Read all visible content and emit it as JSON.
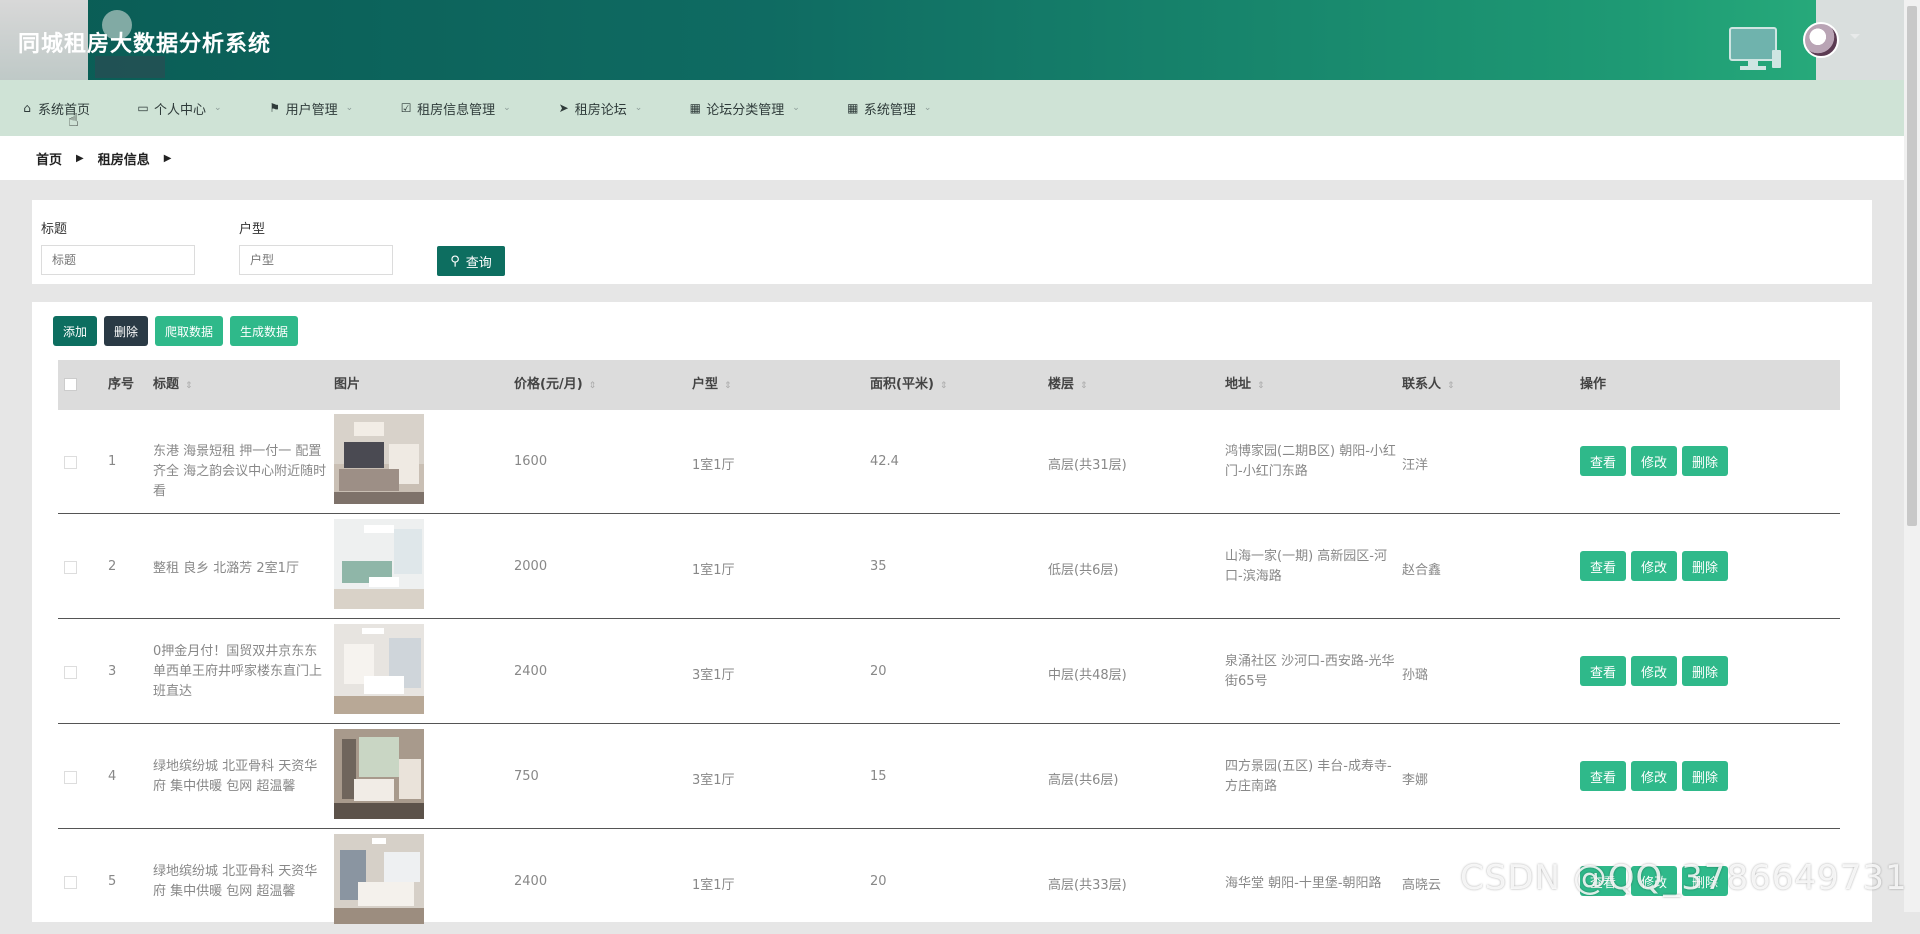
{
  "header": {
    "title": "同城租房大数据分析系统"
  },
  "nav": {
    "items": [
      {
        "label": "系统首页",
        "icon": "home-icon",
        "caret": false
      },
      {
        "label": "个人中心",
        "icon": "card-icon",
        "caret": true
      },
      {
        "label": "用户管理",
        "icon": "flag-icon",
        "caret": true
      },
      {
        "label": "租房信息管理",
        "icon": "check-square-icon",
        "caret": true
      },
      {
        "label": "租房论坛",
        "icon": "send-icon",
        "caret": true
      },
      {
        "label": "论坛分类管理",
        "icon": "grid-icon",
        "caret": true
      },
      {
        "label": "系统管理",
        "icon": "grid-icon",
        "caret": true
      }
    ]
  },
  "breadcrumb": {
    "items": [
      "首页",
      "租房信息"
    ]
  },
  "search": {
    "title_label": "标题",
    "title_placeholder": "标题",
    "layout_label": "户型",
    "layout_placeholder": "户型",
    "button_label": "查询"
  },
  "toolbar": {
    "add": "添加",
    "delete": "删除",
    "crawl": "爬取数据",
    "generate": "生成数据"
  },
  "table": {
    "columns": [
      "序号",
      "标题",
      "图片",
      "价格(元/月)",
      "户型",
      "面积(平米)",
      "楼层",
      "地址",
      "联系人",
      "操作"
    ],
    "ops": {
      "view": "查看",
      "edit": "修改",
      "delete": "删除"
    },
    "rows": [
      {
        "idx": "1",
        "title": "东港 海景短租 押一付一 配置齐全 海之韵会议中心附近随时看",
        "price": "1600",
        "layout": "1室1厅",
        "area": "42.4",
        "floor": "高层(共31层)",
        "addr": "鸿博家园(二期B区) 朝阳-小红门-小红门东路",
        "contact": "汪洋"
      },
      {
        "idx": "2",
        "title": "整租 良乡 北潞芳 2室1厅",
        "price": "2000",
        "layout": "1室1厅",
        "area": "35",
        "floor": "低层(共6层)",
        "addr": "山海一家(一期) 高新园区-河口-滨海路",
        "contact": "赵合鑫"
      },
      {
        "idx": "3",
        "title": "0押金月付！国贸双井京东东单西单王府井呼家楼东直门上班直达",
        "price": "2400",
        "layout": "3室1厅",
        "area": "20",
        "floor": "中层(共48层)",
        "addr": "泉涌社区 沙河口-西安路-光华街65号",
        "contact": "孙璐"
      },
      {
        "idx": "4",
        "title": "绿地缤纷城 北亚骨科 天资华府 集中供暖 包网 超温馨",
        "price": "750",
        "layout": "3室1厅",
        "area": "15",
        "floor": "高层(共6层)",
        "addr": "四方景园(五区) 丰台-成寿寺-方庄南路",
        "contact": "李娜"
      },
      {
        "idx": "5",
        "title": "绿地缤纷城 北亚骨科 天资华府 集中供暖 包网 超温馨",
        "price": "2400",
        "layout": "1室1厅",
        "area": "20",
        "floor": "高层(共33层)",
        "addr": "海华堂 朝阳-十里堡-朝阳路",
        "contact": "高晓云"
      }
    ]
  },
  "watermark": "CSDN @QQ_3786649731"
}
